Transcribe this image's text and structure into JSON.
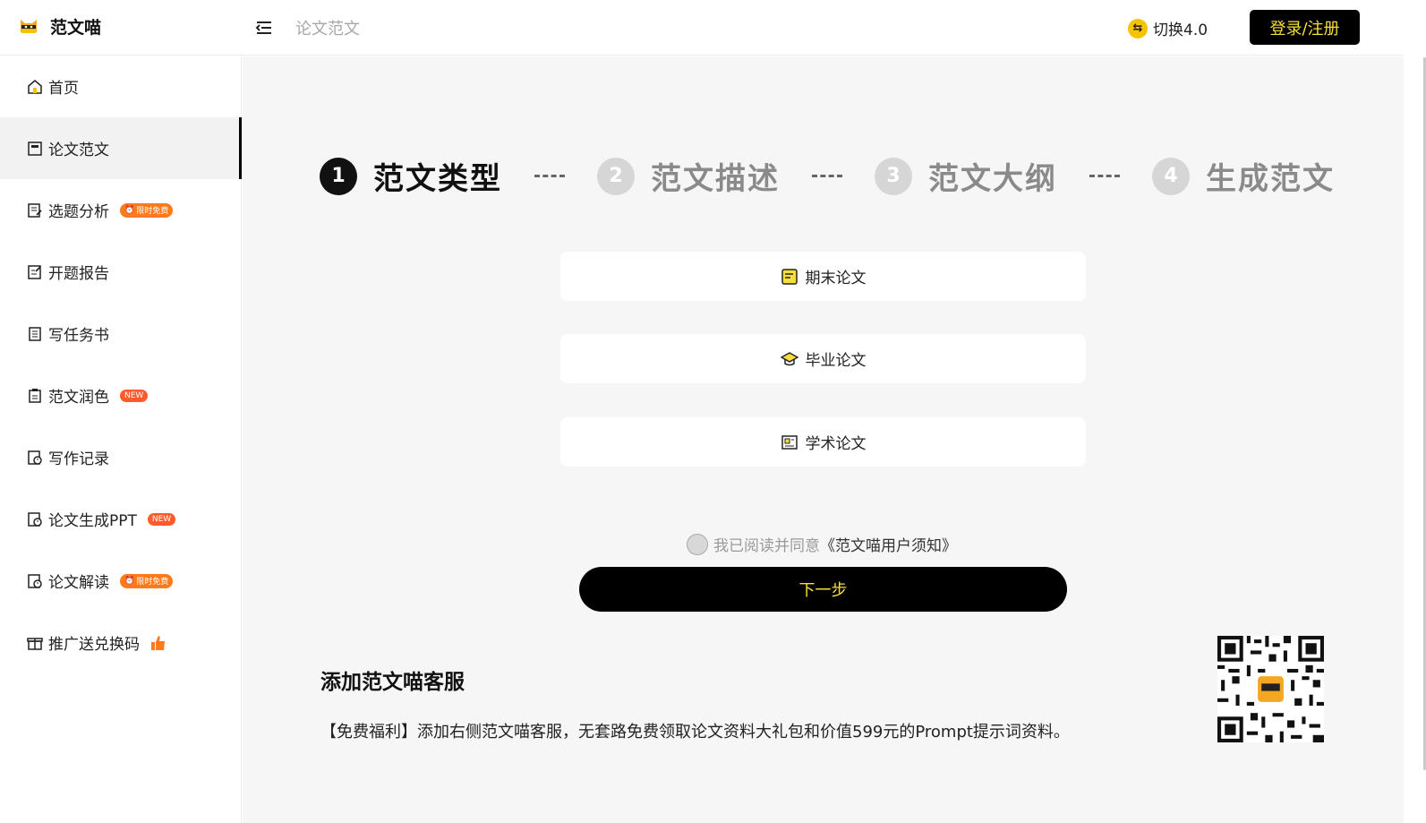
{
  "header": {
    "logo_text": "范文喵",
    "breadcrumb": "论文范文",
    "switch_label": "切换4.0",
    "login_label": "登录/注册"
  },
  "sidebar": {
    "items": [
      {
        "label": "首页",
        "icon": "home-icon"
      },
      {
        "label": "论文范文",
        "icon": "document-icon",
        "active": true
      },
      {
        "label": "选题分析",
        "icon": "edit-list-icon",
        "badge": "限时免费"
      },
      {
        "label": "开题报告",
        "icon": "edit-doc-icon"
      },
      {
        "label": "写任务书",
        "icon": "clipboard-icon"
      },
      {
        "label": "范文润色",
        "icon": "clipboard-edit-icon",
        "badge": "NEW"
      },
      {
        "label": "写作记录",
        "icon": "history-icon"
      },
      {
        "label": "论文生成PPT",
        "icon": "ppt-icon",
        "badge": "NEW"
      },
      {
        "label": "论文解读",
        "icon": "read-icon",
        "badge": "限时免费"
      },
      {
        "label": "推广送兑换码",
        "icon": "gift-icon",
        "extra_icon": "thumbs-up-icon"
      }
    ]
  },
  "steps": [
    {
      "number": "1",
      "label": "范文类型",
      "state": "active"
    },
    {
      "number": "2",
      "label": "范文描述",
      "state": "inactive"
    },
    {
      "number": "3",
      "label": "范文大纲",
      "state": "inactive"
    },
    {
      "number": "4",
      "label": "生成范文",
      "state": "inactive"
    }
  ],
  "options": [
    {
      "label": "期末论文",
      "icon": "note-icon"
    },
    {
      "label": "毕业论文",
      "icon": "graduation-cap-icon"
    },
    {
      "label": "学术论文",
      "icon": "newspaper-icon"
    }
  ],
  "agreement": {
    "text": "我已阅读并同意",
    "link": "《范文喵用户须知》"
  },
  "next_label": "下一步",
  "customer_service": {
    "title": "添加范文喵客服",
    "description": "【免费福利】添加右侧范文喵客服，无套路免费领取论文资料大礼包和价值599元的Prompt提示词资料。"
  },
  "colors": {
    "accent": "#000000",
    "accent_text": "#f7df3b",
    "badge_free": "#ff7a1a",
    "badge_new": "#ff5a2a",
    "main_bg": "#f6f6f6"
  }
}
